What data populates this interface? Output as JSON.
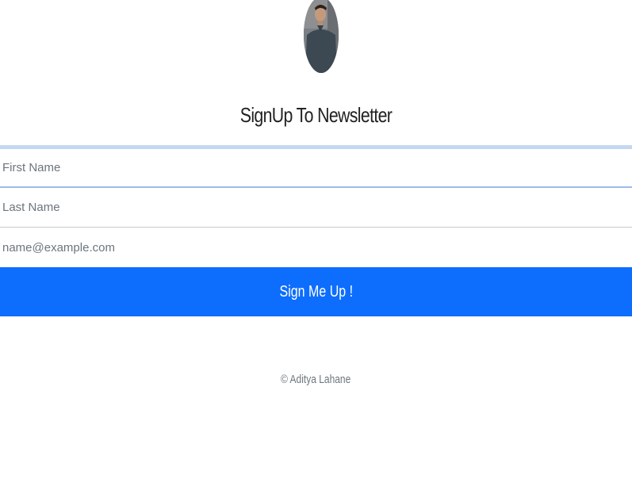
{
  "header": {
    "avatar_icon": "profile-photo",
    "title": "SignUp To Newsletter"
  },
  "form": {
    "first_name": {
      "placeholder": "First Name",
      "value": ""
    },
    "last_name": {
      "placeholder": "Last Name",
      "value": ""
    },
    "email": {
      "placeholder": "name@example.com",
      "value": ""
    },
    "submit_label": "Sign Me Up !"
  },
  "footer": {
    "copyright": "© Aditya Lahane"
  },
  "colors": {
    "accent": "#0d6efd",
    "focus_border": "#c4d7f2",
    "muted_text": "#6c757d"
  }
}
